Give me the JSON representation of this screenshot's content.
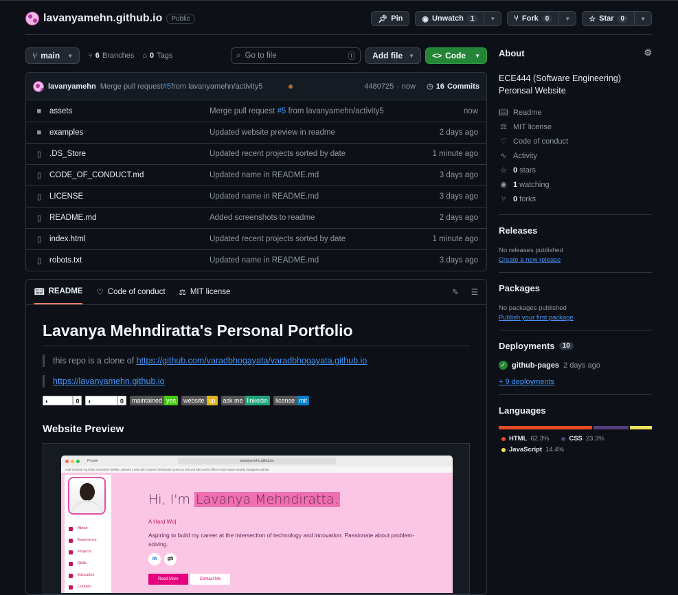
{
  "repo": {
    "name": "lavanyamehn.github.io",
    "visibility": "Public"
  },
  "header_buttons": {
    "pin": "Pin",
    "unwatch": "Unwatch",
    "unwatch_count": "1",
    "fork": "Fork",
    "fork_count": "0",
    "star": "Star",
    "star_count": "0"
  },
  "toolbar": {
    "branch": "main",
    "branches_count": "6",
    "branches_label": "Branches",
    "tags_count": "0",
    "tags_label": "Tags",
    "search_placeholder": "Go to file",
    "search_key": "t",
    "add_file": "Add file",
    "code": "Code"
  },
  "commit": {
    "user": "lavanyamehn",
    "msg_pre": "Merge pull request ",
    "msg_link": "#5",
    "msg_post": " from lavanyamehn/activity5",
    "hash": "4480725",
    "sep": " · ",
    "time": "now",
    "commits_count": "16",
    "commits_label": "Commits"
  },
  "files": [
    {
      "type": "dir",
      "name": "assets",
      "msg_pre": "Merge pull request ",
      "msg_link": "#5",
      "msg_post": " from lavanyamehn/activity5",
      "time": "now"
    },
    {
      "type": "dir",
      "name": "examples",
      "msg_pre": "Updated website preview in readme",
      "msg_link": "",
      "msg_post": "",
      "time": "2 days ago"
    },
    {
      "type": "file",
      "name": ".DS_Store",
      "msg_pre": "Updated recent projects sorted by date",
      "msg_link": "",
      "msg_post": "",
      "time": "1 minute ago"
    },
    {
      "type": "file",
      "name": "CODE_OF_CONDUCT.md",
      "msg_pre": "Updated name in README.md",
      "msg_link": "",
      "msg_post": "",
      "time": "3 days ago"
    },
    {
      "type": "file",
      "name": "LICENSE",
      "msg_pre": "Updated name in README.md",
      "msg_link": "",
      "msg_post": "",
      "time": "3 days ago"
    },
    {
      "type": "file",
      "name": "README.md",
      "msg_pre": "Added screenshots to readme",
      "msg_link": "",
      "msg_post": "",
      "time": "2 days ago"
    },
    {
      "type": "file",
      "name": "index.html",
      "msg_pre": "Updated recent projects sorted by date",
      "msg_link": "",
      "msg_post": "",
      "time": "1 minute ago"
    },
    {
      "type": "file",
      "name": "robots.txt",
      "msg_pre": "Updated name in README.md",
      "msg_link": "",
      "msg_post": "",
      "time": "3 days ago"
    }
  ],
  "readme_tabs": {
    "readme": "README",
    "conduct": "Code of conduct",
    "license": "MIT license"
  },
  "readme": {
    "title": "Lavanya Mehndiratta's Personal Portfolio",
    "clone_pre": "this repo is a clone of ",
    "clone_link": "https://github.com/varadbhogayata/varadbhogayata.github.io",
    "site_link": "https://lavanyamehn.github.io",
    "preview_heading": "Website Preview",
    "shields": [
      {
        "l": "Stars",
        "r": "0"
      },
      {
        "l": "Forks",
        "r": "0"
      },
      {
        "l": "maintained",
        "r": "yes",
        "c": "#4c1"
      },
      {
        "l": "website",
        "r": "up",
        "c": "#dfb317"
      },
      {
        "l": "ask me",
        "r": "linkedin",
        "c": "#1fa37b"
      },
      {
        "l": "license",
        "r": "mit",
        "c": "#007ec6"
      }
    ]
  },
  "preview": {
    "url": "lavanyamehn.github.io",
    "tab": "Private",
    "bookmarks": "mail   Outlook   YouTube   OneDrive   Netflix   LinkedIn   Leetcode   Classes   Textbooks   Quercus   Discord   Microsoft Office Home   spare-spotify   Instagram   github",
    "nav": [
      "About",
      "Experience",
      "Projects",
      "Skills",
      "Education",
      "Contact"
    ],
    "hi_pre": "Hi, I'm ",
    "hi_name": "Lavanya Mehndiratta.",
    "typing": "A Hard Wo|",
    "desc": "Aspiring to build my career at the intersection of technology and innovation. Passionate about problem-solving.",
    "social": [
      "in",
      "gh"
    ],
    "read_more": "Read More",
    "contact_me": "Contact Me"
  },
  "about": {
    "heading": "About",
    "desc": "ECE444 (Software Engineering) Peronsal Website",
    "items": [
      {
        "icon": "book-icon",
        "label": "Readme",
        "num": ""
      },
      {
        "icon": "scale-icon",
        "label": "MIT license",
        "num": ""
      },
      {
        "icon": "heart-icon",
        "label": "Code of conduct",
        "num": ""
      },
      {
        "icon": "pulse-icon",
        "label": "Activity",
        "num": ""
      },
      {
        "icon": "star-icon",
        "label": " stars",
        "num": "0"
      },
      {
        "icon": "eye-icon",
        "label": " watching",
        "num": "1"
      },
      {
        "icon": "fork-icon",
        "label": " forks",
        "num": "0"
      }
    ]
  },
  "releases": {
    "heading": "Releases",
    "none": "No releases published",
    "link": "Create a new release"
  },
  "packages": {
    "heading": "Packages",
    "none": "No packages published",
    "link": "Publish your first package"
  },
  "deployments": {
    "heading": "Deployments",
    "count": "10",
    "env": "github-pages",
    "time": "2 days ago",
    "more": "+ 9 deployments"
  },
  "languages": {
    "heading": "Languages",
    "items": [
      {
        "name": "HTML",
        "pct": "62.3%",
        "value": 62.3,
        "color": "#e34c26"
      },
      {
        "name": "CSS",
        "pct": "23.3%",
        "value": 23.3,
        "color": "#563d7c"
      },
      {
        "name": "JavaScript",
        "pct": "14.4%",
        "value": 14.4,
        "color": "#f1e05a"
      }
    ]
  }
}
